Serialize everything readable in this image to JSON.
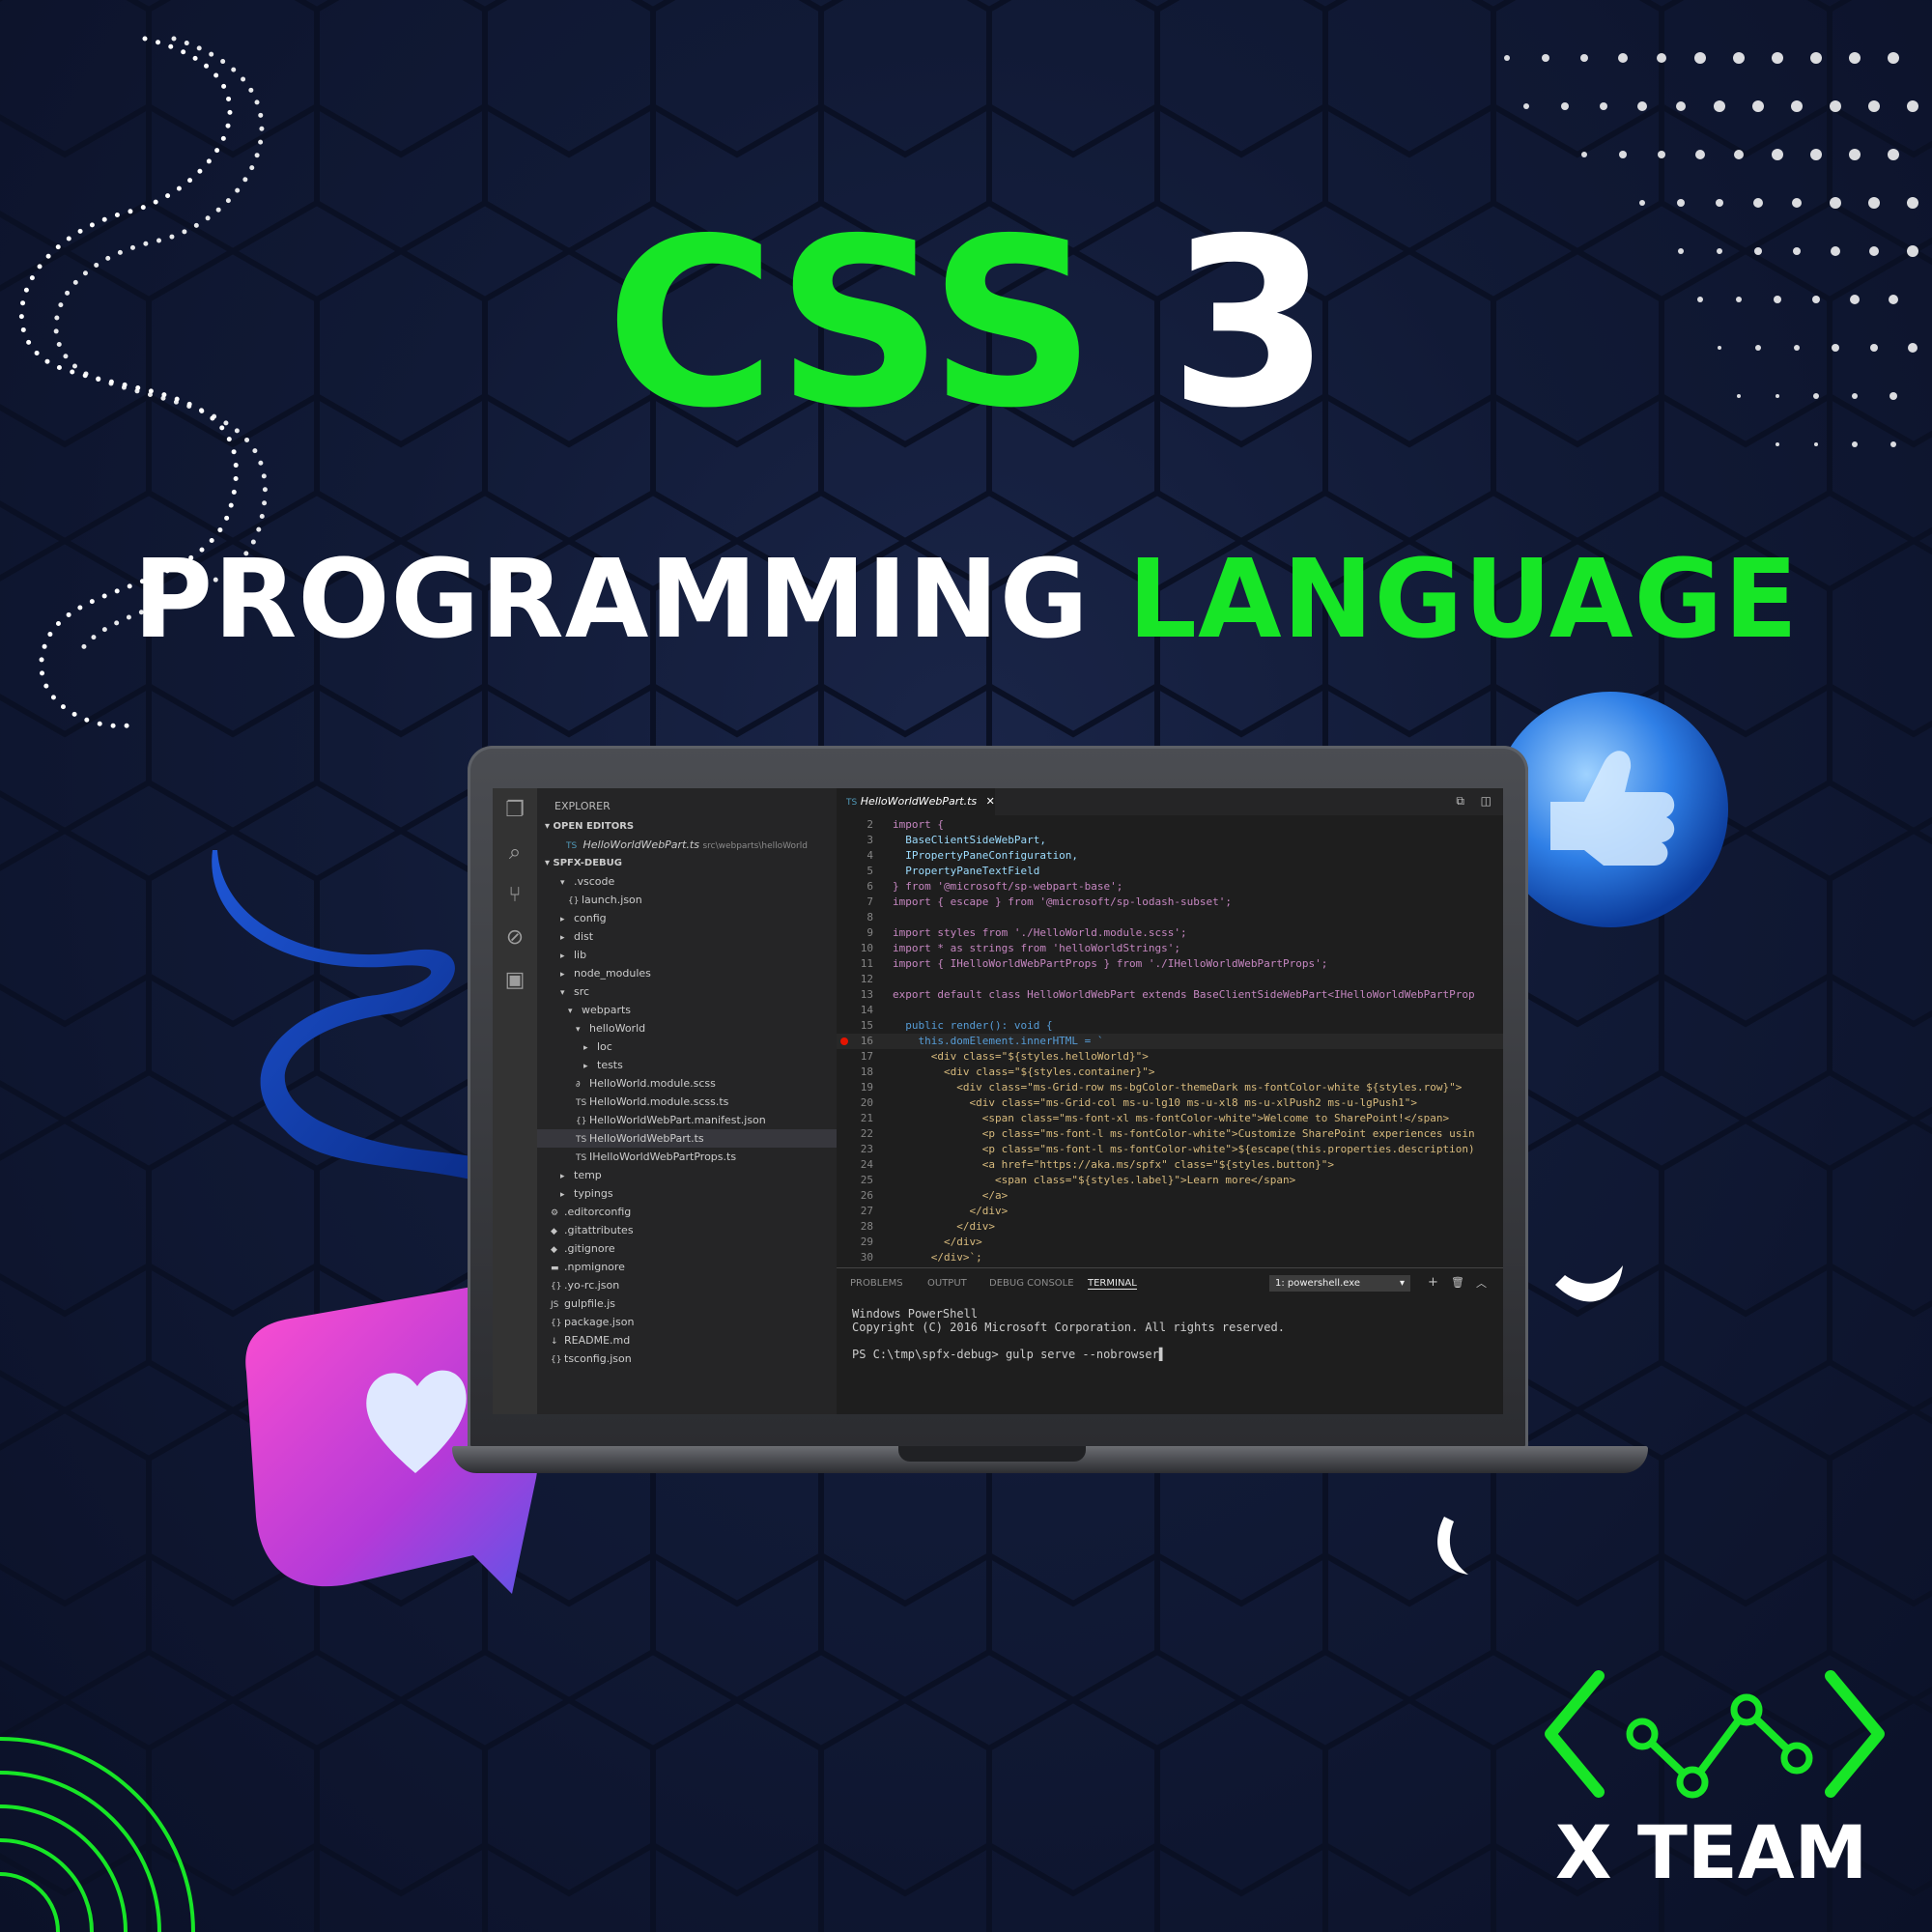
{
  "headline": {
    "part1": "CSS",
    "part2": "3",
    "part3": "PROGRAMMING",
    "part4": "LANGUAGE"
  },
  "ide": {
    "explorer_title": "EXPLORER",
    "open_editors_label": "OPEN EDITORS",
    "open_file": "HelloWorldWebPart.ts",
    "open_file_path": "src\\webparts\\helloWorld",
    "project_label": "SPFX-DEBUG",
    "tree": [
      {
        "label": ".vscode",
        "icon": "▾"
      },
      {
        "label": "launch.json",
        "icon": "{}"
      },
      {
        "label": "config",
        "icon": "▸"
      },
      {
        "label": "dist",
        "icon": "▸"
      },
      {
        "label": "lib",
        "icon": "▸"
      },
      {
        "label": "node_modules",
        "icon": "▸"
      },
      {
        "label": "src",
        "icon": "▾"
      },
      {
        "label": "webparts",
        "icon": "▾"
      },
      {
        "label": "helloWorld",
        "icon": "▾"
      },
      {
        "label": "loc",
        "icon": "▸"
      },
      {
        "label": "tests",
        "icon": "▸"
      },
      {
        "label": "HelloWorld.module.scss",
        "icon": "∂"
      },
      {
        "label": "HelloWorld.module.scss.ts",
        "icon": "TS"
      },
      {
        "label": "HelloWorldWebPart.manifest.json",
        "icon": "{}"
      },
      {
        "label": "HelloWorldWebPart.ts",
        "icon": "TS"
      },
      {
        "label": "IHelloWorldWebPartProps.ts",
        "icon": "TS"
      },
      {
        "label": "temp",
        "icon": "▸"
      },
      {
        "label": "typings",
        "icon": "▸"
      },
      {
        "label": ".editorconfig",
        "icon": "⚙"
      },
      {
        "label": ".gitattributes",
        "icon": "◆"
      },
      {
        "label": ".gitignore",
        "icon": "◆"
      },
      {
        "label": ".npmignore",
        "icon": "▬"
      },
      {
        "label": ".yo-rc.json",
        "icon": "{}"
      },
      {
        "label": "gulpfile.js",
        "icon": "JS"
      },
      {
        "label": "package.json",
        "icon": "{}"
      },
      {
        "label": "README.md",
        "icon": "↓"
      },
      {
        "label": "tsconfig.json",
        "icon": "{}"
      }
    ],
    "tab_label": "HelloWorldWebPart.ts",
    "code": [
      {
        "n": "2",
        "t": "import {"
      },
      {
        "n": "3",
        "t": "  BaseClientSideWebPart,"
      },
      {
        "n": "4",
        "t": "  IPropertyPaneConfiguration,"
      },
      {
        "n": "5",
        "t": "  PropertyPaneTextField"
      },
      {
        "n": "6",
        "t": "} from '@microsoft/sp-webpart-base';"
      },
      {
        "n": "7",
        "t": "import { escape } from '@microsoft/sp-lodash-subset';"
      },
      {
        "n": "8",
        "t": ""
      },
      {
        "n": "9",
        "t": "import styles from './HelloWorld.module.scss';"
      },
      {
        "n": "10",
        "t": "import * as strings from 'helloWorldStrings';"
      },
      {
        "n": "11",
        "t": "import { IHelloWorldWebPartProps } from './IHelloWorldWebPartProps';"
      },
      {
        "n": "12",
        "t": ""
      },
      {
        "n": "13",
        "t": "export default class HelloWorldWebPart extends BaseClientSideWebPart<IHelloWorldWebPartProp"
      },
      {
        "n": "14",
        "t": ""
      },
      {
        "n": "15",
        "t": "  public render(): void {"
      },
      {
        "n": "16",
        "t": "    this.domElement.innerHTML = `"
      },
      {
        "n": "17",
        "t": "      <div class=\"${styles.helloWorld}\">"
      },
      {
        "n": "18",
        "t": "        <div class=\"${styles.container}\">"
      },
      {
        "n": "19",
        "t": "          <div class=\"ms-Grid-row ms-bgColor-themeDark ms-fontColor-white ${styles.row}\">"
      },
      {
        "n": "20",
        "t": "            <div class=\"ms-Grid-col ms-u-lg10 ms-u-xl8 ms-u-xlPush2 ms-u-lgPush1\">"
      },
      {
        "n": "21",
        "t": "              <span class=\"ms-font-xl ms-fontColor-white\">Welcome to SharePoint!</span>"
      },
      {
        "n": "22",
        "t": "              <p class=\"ms-font-l ms-fontColor-white\">Customize SharePoint experiences usin"
      },
      {
        "n": "23",
        "t": "              <p class=\"ms-font-l ms-fontColor-white\">${escape(this.properties.description)"
      },
      {
        "n": "24",
        "t": "              <a href=\"https://aka.ms/spfx\" class=\"${styles.button}\">"
      },
      {
        "n": "25",
        "t": "                <span class=\"${styles.label}\">Learn more</span>"
      },
      {
        "n": "26",
        "t": "              </a>"
      },
      {
        "n": "27",
        "t": "            </div>"
      },
      {
        "n": "28",
        "t": "          </div>"
      },
      {
        "n": "29",
        "t": "        </div>"
      },
      {
        "n": "30",
        "t": "      </div>`;"
      }
    ],
    "panel_tabs": [
      "PROBLEMS",
      "OUTPUT",
      "DEBUG CONSOLE",
      "TERMINAL"
    ],
    "terminal_select": "1: powershell.exe",
    "terminal_lines": [
      "Windows PowerShell",
      "Copyright (C) 2016 Microsoft Corporation. All rights reserved.",
      "",
      "PS C:\\tmp\\spfx-debug> gulp serve --nobrowser▌"
    ]
  },
  "logo": {
    "text": "X TEAM"
  },
  "colors": {
    "accent_green": "#17e626",
    "background": "#111a36",
    "heart_bubble": "#c43bd6",
    "thumb_ball": "#2f7fe6"
  },
  "icons": [
    "heart-icon",
    "thumbs-up-icon",
    "code-brackets-logo-icon"
  ]
}
